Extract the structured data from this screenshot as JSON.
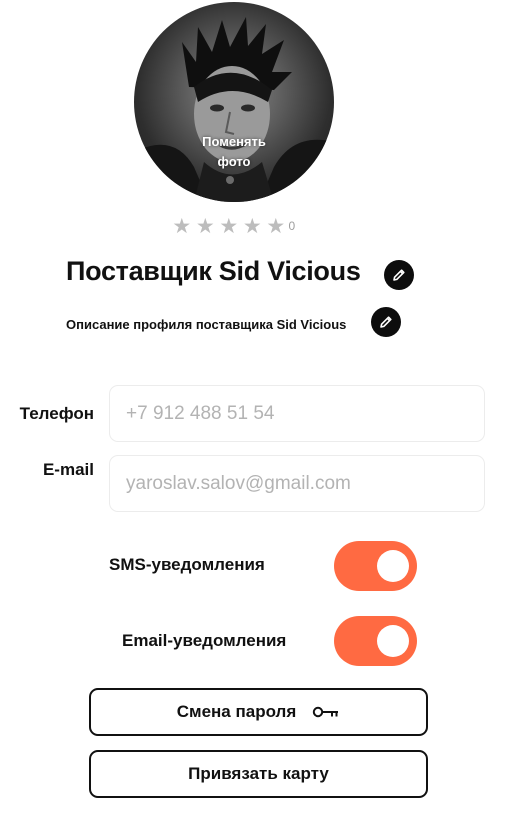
{
  "profile": {
    "avatar_overlay_line1": "Поменять",
    "avatar_overlay_line2": "фото",
    "rating": 0,
    "rating_count": "0",
    "name": "Поставщик Sid Vicious",
    "description": "Описание профиля поставщика Sid Vicious"
  },
  "contacts": {
    "phone_label": "Телефон",
    "phone_placeholder": "+7 912 488 51 54",
    "email_label": "E-mail",
    "email_placeholder": "yaroslav.salov@gmail.com"
  },
  "notifications": {
    "sms_label": "SMS-уведомления",
    "sms_enabled": true,
    "email_label": "Email-уведомления",
    "email_enabled": true
  },
  "actions": {
    "change_password_label": "Смена пароля",
    "link_card_label": "Привязать карту"
  },
  "colors": {
    "accent": "#ff6a42",
    "star_inactive": "#bdbdbd",
    "dark": "#0d0d0d"
  },
  "icons": {
    "edit": "pencil-icon",
    "password": "key-icon",
    "rating": "star-icon"
  }
}
